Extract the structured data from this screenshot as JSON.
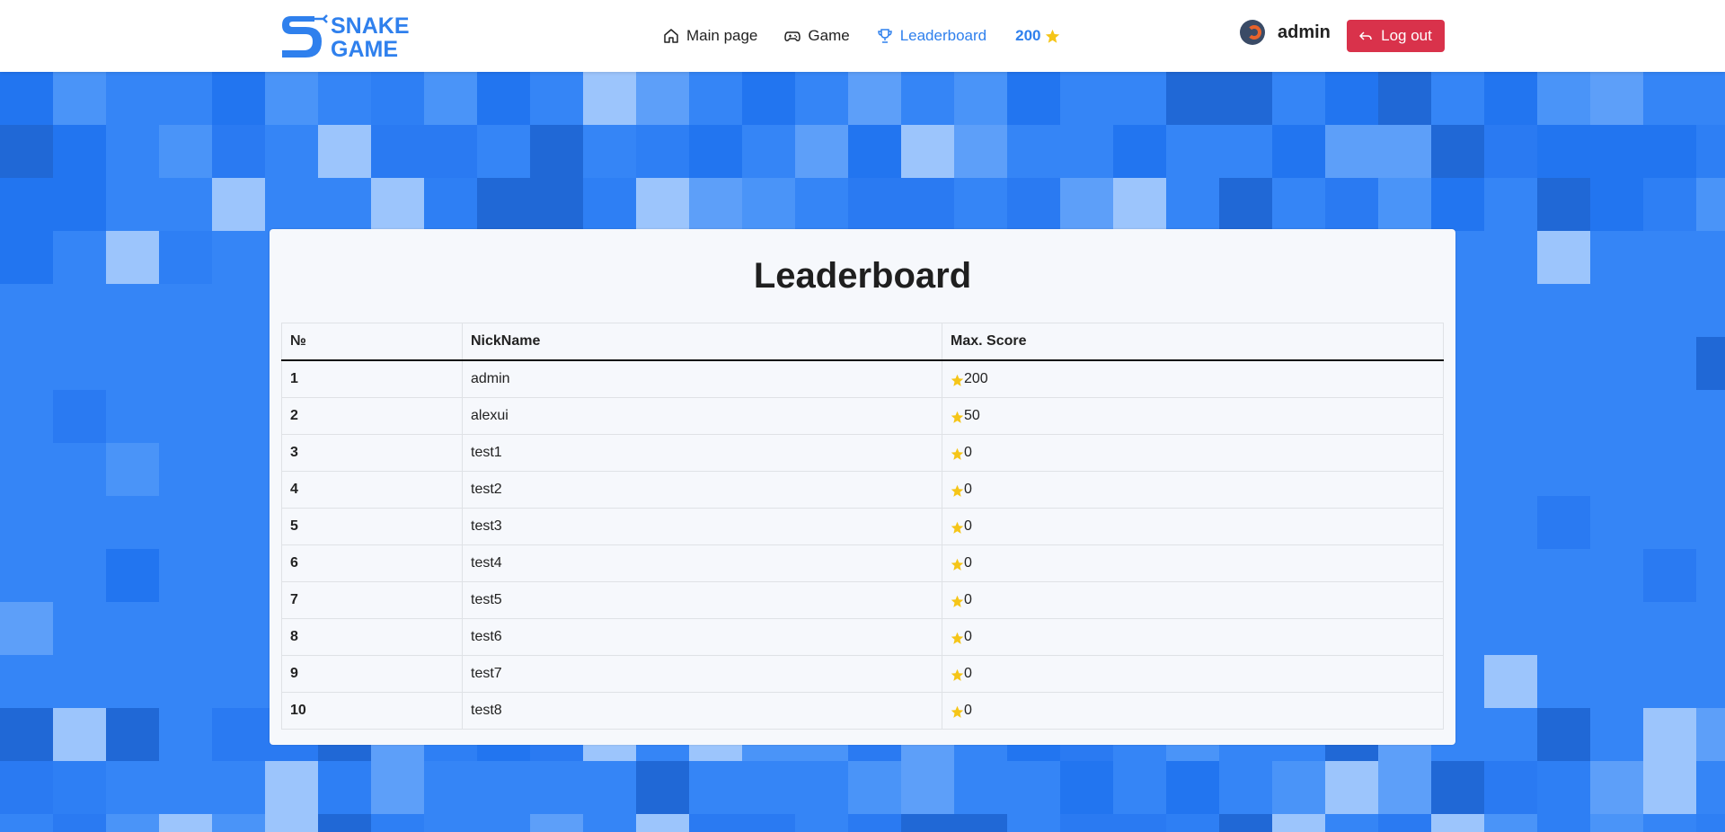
{
  "header": {
    "logo_line1": "SNAKE",
    "logo_line2": "GAME",
    "nav": [
      {
        "label": "Main page",
        "icon": "home-icon"
      },
      {
        "label": "Game",
        "icon": "gamepad-icon"
      },
      {
        "label": "Leaderboard",
        "icon": "trophy-icon",
        "active": true
      }
    ],
    "score": "200",
    "username": "admin",
    "logout_label": "Log out"
  },
  "leaderboard": {
    "title": "Leaderboard",
    "columns": [
      "№",
      "NickName",
      "Max. Score"
    ],
    "rows": [
      {
        "rank": "1",
        "nick": "admin",
        "score": "200"
      },
      {
        "rank": "2",
        "nick": "alexui",
        "score": "50"
      },
      {
        "rank": "3",
        "nick": "test1",
        "score": "0"
      },
      {
        "rank": "4",
        "nick": "test2",
        "score": "0"
      },
      {
        "rank": "5",
        "nick": "test3",
        "score": "0"
      },
      {
        "rank": "6",
        "nick": "test4",
        "score": "0"
      },
      {
        "rank": "7",
        "nick": "test5",
        "score": "0"
      },
      {
        "rank": "8",
        "nick": "test6",
        "score": "0"
      },
      {
        "rank": "9",
        "nick": "test7",
        "score": "0"
      },
      {
        "rank": "10",
        "nick": "test8",
        "score": "0"
      }
    ]
  },
  "colors": {
    "accent": "#2f80ed",
    "logout": "#d9324b",
    "star": "#f5c518",
    "background": "#3585f6"
  }
}
